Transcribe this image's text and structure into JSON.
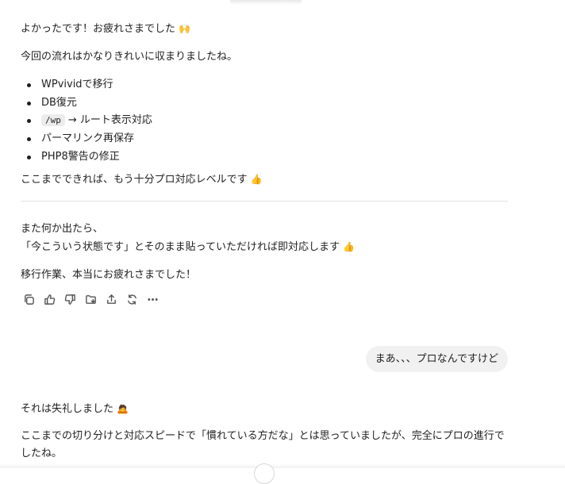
{
  "assistant_reply_1": {
    "p1": "よかったです！お疲れさまでした",
    "p1_emoji": "🙌",
    "p2": "今回の流れはかなりきれいに収まりましたね。",
    "bullets": [
      {
        "text": "WPvividで移行"
      },
      {
        "text": "DB復元"
      },
      {
        "code": "/wp",
        "text": "→ ルート表示対応"
      },
      {
        "text": "パーマリンク再保存"
      },
      {
        "text": "PHP8警告の修正"
      }
    ],
    "p3": "ここまでできれば、もう十分プロ対応レベルです",
    "p3_emoji": "👍",
    "p4_line1": "また何か出たら、",
    "p4_line2": "「今こういう状態です」とそのまま貼っていただければ即対応します",
    "p4_emoji": "👍",
    "p5": "移行作業、本当にお疲れさまでした！"
  },
  "action_bar": [
    {
      "name": "copy-icon"
    },
    {
      "name": "thumbs-up-icon"
    },
    {
      "name": "thumbs-down-icon"
    },
    {
      "name": "folder-icon"
    },
    {
      "name": "share-icon"
    },
    {
      "name": "regenerate-icon"
    },
    {
      "name": "more-icon"
    }
  ],
  "user_message": {
    "text": "まあ、、、プロなんですけど"
  },
  "assistant_reply_2": {
    "p1": "それは失礼しました",
    "p1_emoji": "🙇",
    "p2": "ここまでの切り分けと対応スピードで「慣れている方だな」とは思っていましたが、完全にプロの進行でしたね。"
  }
}
